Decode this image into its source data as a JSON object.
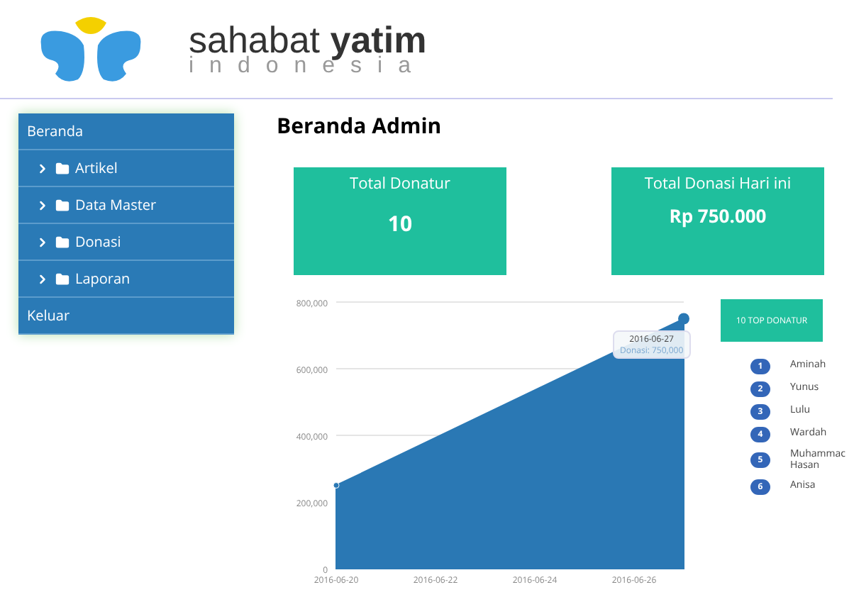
{
  "brand": {
    "name_light": "sahabat",
    "name_bold": "yatim",
    "tagline": "indonesia"
  },
  "sidebar": {
    "items": [
      {
        "label": "Beranda",
        "kind": "link"
      },
      {
        "label": "Artikel",
        "kind": "folder"
      },
      {
        "label": "Data Master",
        "kind": "folder"
      },
      {
        "label": "Donasi",
        "kind": "folder"
      },
      {
        "label": "Laporan",
        "kind": "folder"
      },
      {
        "label": "Keluar",
        "kind": "link"
      }
    ]
  },
  "page_title": "Beranda Admin",
  "cards": [
    {
      "label": "Total Donatur",
      "value": "10"
    },
    {
      "label": "Total Donasi Hari ini",
      "value": "Rp 750.000"
    }
  ],
  "chart": {
    "chart_data": {
      "type": "area",
      "categories": [
        "2016-06-20",
        null,
        "2016-06-22",
        null,
        "2016-06-24",
        null,
        "2016-06-26",
        null
      ],
      "series": [
        {
          "color": "#2a78b4",
          "values": [
            250000,
            null,
            null,
            null,
            null,
            null,
            null,
            750000
          ]
        }
      ],
      "ylim": [
        0,
        800000
      ],
      "yticks": [
        {
          "value": 0,
          "label": "0"
        },
        {
          "value": 200000,
          "label": "200,000"
        },
        {
          "value": 400000,
          "label": "400,000"
        },
        {
          "value": 600000,
          "label": "600,000"
        },
        {
          "value": 800000,
          "label": "800,000"
        }
      ]
    },
    "tooltip": {
      "title": "2016-06-27",
      "text": "Donasi: 750,000"
    }
  },
  "top_donors": {
    "button": "10 TOP DONATUR",
    "items": [
      {
        "rank": "1",
        "name": "Aminah"
      },
      {
        "rank": "2",
        "name": "Yunus"
      },
      {
        "rank": "3",
        "name": "Lulu"
      },
      {
        "rank": "4",
        "name": "Wardah"
      },
      {
        "rank": "5",
        "name": "Muhammac Hasan"
      },
      {
        "rank": "6",
        "name": "Anisa"
      }
    ]
  }
}
